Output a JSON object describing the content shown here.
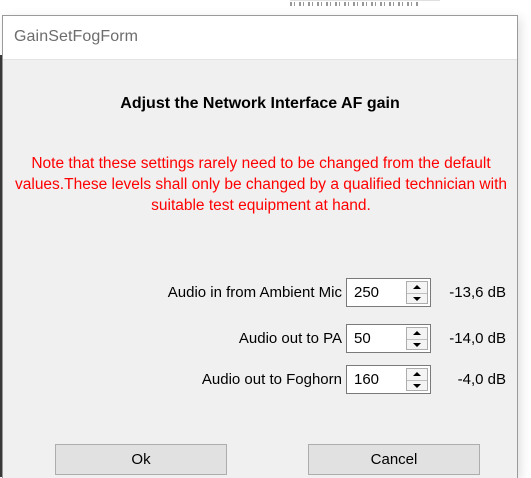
{
  "window": {
    "title": "GainSetFogForm"
  },
  "heading": "Adjust the Network Interface AF gain",
  "note": "Note that these settings rarely need to be changed from the default values.These levels shall only be changed by a qualified technician with suitable test equipment at hand.",
  "rows": [
    {
      "label": "Audio in from Ambient Mic",
      "value": "250",
      "db": "-13,6 dB"
    },
    {
      "label": "Audio out to PA",
      "value": "50",
      "db": "-14,0 dB"
    },
    {
      "label": "Audio out to Foghorn",
      "value": "160",
      "db": "-4,0 dB"
    }
  ],
  "buttons": {
    "ok": "Ok",
    "cancel": "Cancel"
  },
  "colors": {
    "note": "#ff0000",
    "dialog_bg": "#f0f0f0",
    "title_text": "#6d6d6d"
  }
}
